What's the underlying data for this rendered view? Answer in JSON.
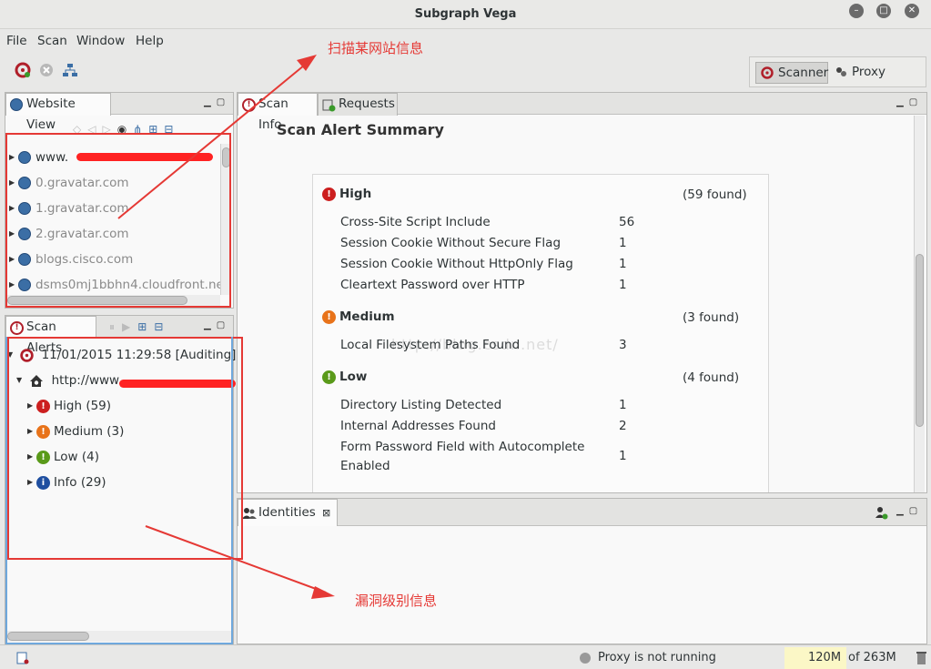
{
  "window": {
    "title": "Subgraph Vega"
  },
  "menu": [
    "File",
    "Scan",
    "Window",
    "Help"
  ],
  "perspectives": {
    "scanner": "Scanner",
    "proxy": "Proxy"
  },
  "website_view": {
    "tab": "Website View",
    "hosts": [
      "www.",
      "0.gravatar.com",
      "1.gravatar.com",
      "2.gravatar.com",
      "blogs.cisco.com",
      "dsms0mj1bbhn4.cloudfront.ne"
    ]
  },
  "scan_alerts": {
    "tab": "Scan Alerts",
    "scan": "11/01/2015 11:29:58 [Auditing]",
    "host": "http://www.",
    "levels": [
      {
        "label": "High (59)",
        "color": "#cc1f1f",
        "icon": "exclamation-icon"
      },
      {
        "label": "Medium (3)",
        "color": "#e8731a",
        "icon": "exclamation-icon"
      },
      {
        "label": "Low (4)",
        "color": "#5a9a1a",
        "icon": "exclamation-icon"
      },
      {
        "label": "Info (29)",
        "color": "#1f4fa0",
        "icon": "info-icon"
      }
    ]
  },
  "scan_info": {
    "tab_info": "Scan Info",
    "tab_requests": "Requests",
    "heading": "Scan Alert Summary",
    "watermark": "http://blog.csdn.net/",
    "groups": [
      {
        "name": "High",
        "found": "(59 found)",
        "color": "#cc1f1f",
        "items": [
          {
            "label": "Cross-Site Script Include",
            "count": "56"
          },
          {
            "label": "Session Cookie Without Secure Flag",
            "count": "1"
          },
          {
            "label": "Session Cookie Without HttpOnly Flag",
            "count": "1"
          },
          {
            "label": "Cleartext Password over HTTP",
            "count": "1"
          }
        ]
      },
      {
        "name": "Medium",
        "found": "(3 found)",
        "color": "#e8731a",
        "items": [
          {
            "label": "Local Filesystem Paths Found",
            "count": "3"
          }
        ]
      },
      {
        "name": "Low",
        "found": "(4 found)",
        "color": "#5a9a1a",
        "items": [
          {
            "label": "Directory Listing Detected",
            "count": "1"
          },
          {
            "label": "Internal Addresses Found",
            "count": "2"
          },
          {
            "label": "Form Password Field with Autocomplete",
            "label2": "Enabled",
            "count": "1"
          }
        ]
      }
    ]
  },
  "identities": {
    "tab": "Identities"
  },
  "annotations": {
    "top": "扫描某网站信息",
    "bottom": "漏洞级别信息"
  },
  "status": {
    "proxy": "Proxy is not running",
    "mem_used": "120M",
    "mem_total": "of 263M"
  }
}
